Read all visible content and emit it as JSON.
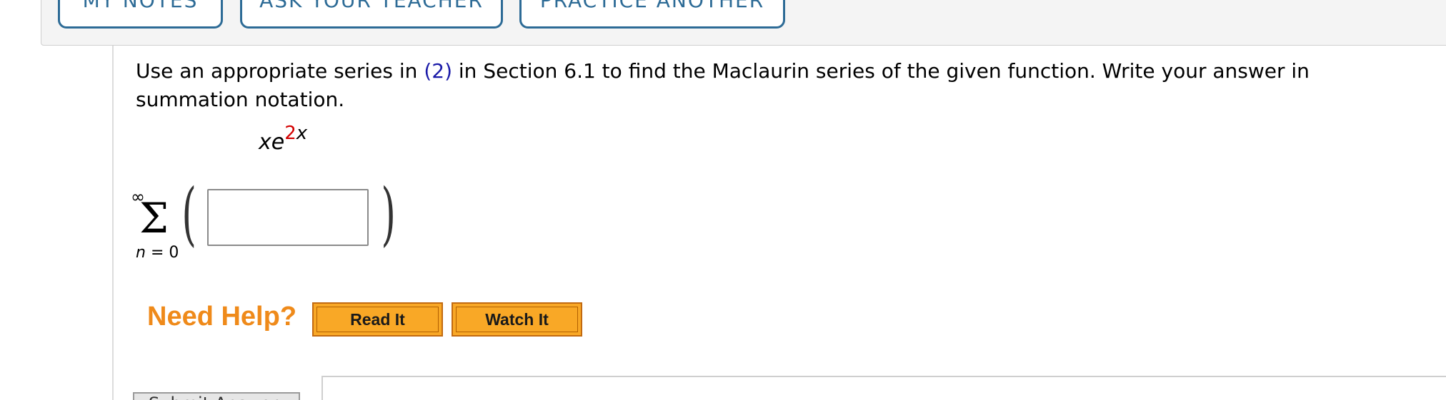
{
  "toolbar": {
    "my_notes": "MY NOTES",
    "ask_teacher": "ASK YOUR TEACHER",
    "practice_another": "PRACTICE ANOTHER"
  },
  "question": {
    "text_before": "Use an appropriate series in ",
    "reference": "(2)",
    "text_after": " in Section 6.1 to find the Maclaurin series of the given function. Write your answer in summation notation."
  },
  "function": {
    "base": "xe",
    "exp_coef": "2",
    "exp_var": "x"
  },
  "summation": {
    "upper": "∞",
    "sigma": "Σ",
    "lower_var": "n",
    "lower_eq": " = ",
    "lower_val": "0",
    "left_paren": "(",
    "right_paren": ")"
  },
  "answer": {
    "value": ""
  },
  "help": {
    "label": "Need Help?",
    "read_it": "Read It",
    "watch_it": "Watch It"
  },
  "submit": {
    "label": "Submit Answer"
  }
}
